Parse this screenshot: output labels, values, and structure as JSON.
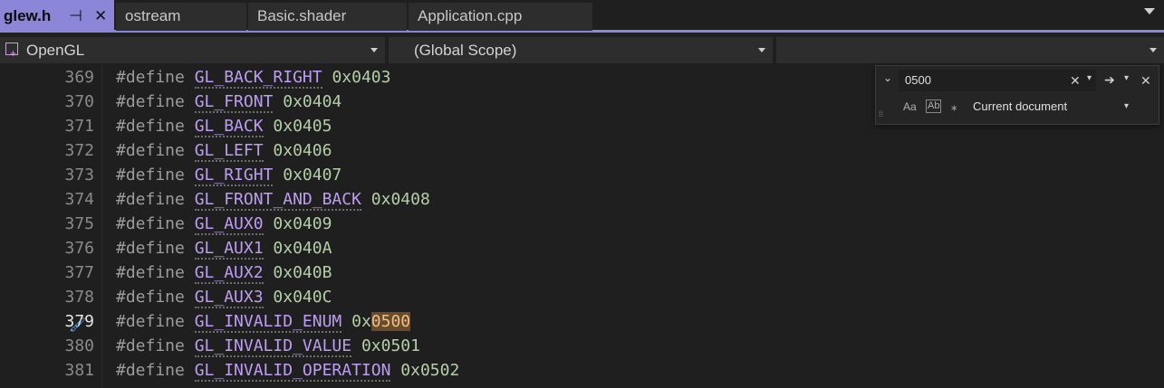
{
  "tabs": [
    {
      "label": "glew.h",
      "active": true
    },
    {
      "label": "ostream",
      "active": false
    },
    {
      "label": "Basic.shader",
      "active": false
    },
    {
      "label": "Application.cpp",
      "active": false
    }
  ],
  "tab_icons": {
    "pin": "⊣",
    "close": "✕"
  },
  "navbar": {
    "project": "OpenGL",
    "scope": "(Global Scope)",
    "member": ""
  },
  "editor": {
    "lines": [
      {
        "num": "369",
        "kw": "#define",
        "name": "GL_BACK_RIGHT",
        "value": "0x0403"
      },
      {
        "num": "370",
        "kw": "#define",
        "name": "GL_FRONT",
        "value": "0x0404"
      },
      {
        "num": "371",
        "kw": "#define",
        "name": "GL_BACK",
        "value": "0x0405"
      },
      {
        "num": "372",
        "kw": "#define",
        "name": "GL_LEFT",
        "value": "0x0406"
      },
      {
        "num": "373",
        "kw": "#define",
        "name": "GL_RIGHT",
        "value": "0x0407"
      },
      {
        "num": "374",
        "kw": "#define",
        "name": "GL_FRONT_AND_BACK",
        "value": "0x0408"
      },
      {
        "num": "375",
        "kw": "#define",
        "name": "GL_AUX0",
        "value": "0x0409"
      },
      {
        "num": "376",
        "kw": "#define",
        "name": "GL_AUX1",
        "value": "0x040A"
      },
      {
        "num": "377",
        "kw": "#define",
        "name": "GL_AUX2",
        "value": "0x040B"
      },
      {
        "num": "378",
        "kw": "#define",
        "name": "GL_AUX3",
        "value": "0x040C"
      },
      {
        "num": "379",
        "kw": "#define",
        "name": "GL_INVALID_ENUM",
        "value_prefix": "0x",
        "value_match": "0500",
        "current": true
      },
      {
        "num": "380",
        "kw": "#define",
        "name": "GL_INVALID_VALUE",
        "value": "0x0501"
      },
      {
        "num": "381",
        "kw": "#define",
        "name": "GL_INVALID_OPERATION",
        "value": "0x0502"
      }
    ]
  },
  "find": {
    "query": "0500",
    "options": {
      "match_case": "Aa",
      "whole_word": "Ab"
    },
    "scope": "Current document"
  },
  "colors": {
    "accent": "#8b86d8",
    "macro": "#bd9df2",
    "number": "#b5cea8",
    "match_highlight": "#6b4a2c"
  }
}
